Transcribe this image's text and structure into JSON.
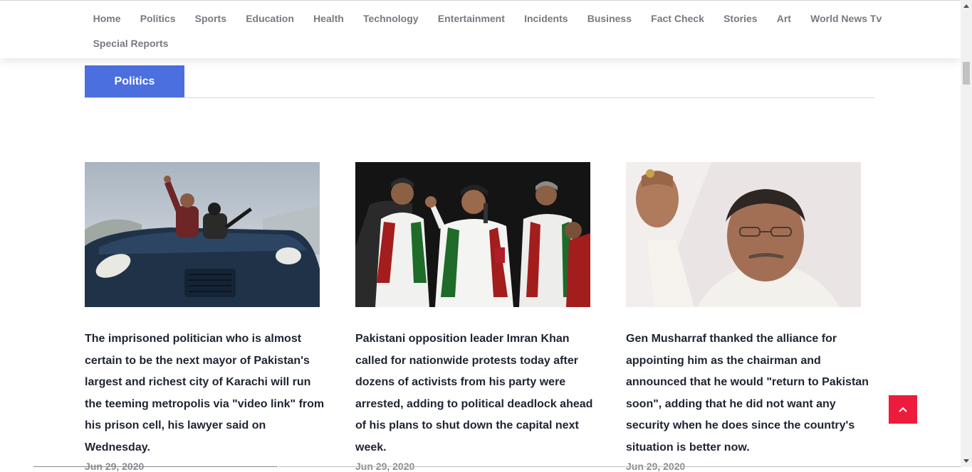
{
  "nav": {
    "row1": [
      "Home",
      "Politics",
      "Sports",
      "Education",
      "Health",
      "Technology",
      "Entertainment",
      "Incidents",
      "Business",
      "Fact Check",
      "Stories",
      "Art",
      "World News Tv"
    ],
    "row2": [
      "Special Reports"
    ]
  },
  "section": {
    "title": "Politics"
  },
  "articles": [
    {
      "headline": "The imprisoned politician who is almost certain to be the next mayor of Pakistan's largest and richest city of Karachi will run the teeming metropolis via \"video link\" from his prison cell, his lawyer said on Wednesday.",
      "date": "Jun 29, 2020"
    },
    {
      "headline": "Pakistani opposition leader Imran Khan called for nationwide protests today after dozens of activists from his party were arrested, adding to political deadlock ahead of his plans to shut down the capital next week.",
      "date": "Jun 29, 2020"
    },
    {
      "headline": "Gen Musharraf thanked the alliance for appointing him as the chairman and announced that he would \"return to Pakistan soon\", adding that he did not want any security when he does since the country's situation is better now.",
      "date": "Jun 29, 2020"
    }
  ],
  "colors": {
    "accent_blue": "#4b6fdf",
    "scroll_top_red": "#ee1c3c",
    "nav_text": "#777a80"
  },
  "icons": {
    "scroll_top": "chevron-up-icon"
  }
}
